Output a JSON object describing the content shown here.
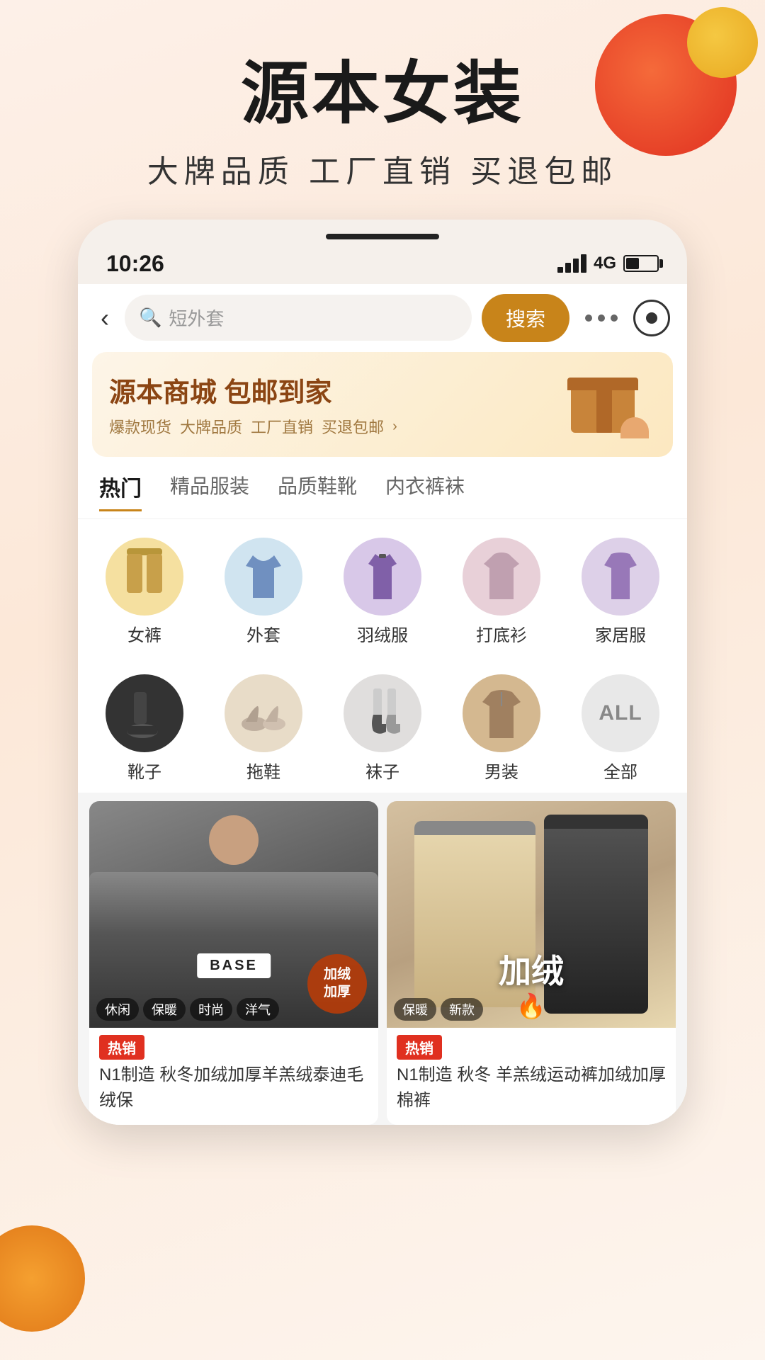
{
  "page": {
    "background": "#fdf0e8"
  },
  "header": {
    "main_title": "源本女装",
    "sub_title": "大牌品质  工厂直销  买退包邮"
  },
  "status_bar": {
    "time": "10:26",
    "signal": "4G"
  },
  "search": {
    "placeholder": "短外套",
    "button_label": "搜索"
  },
  "banner": {
    "title": "源本商城 包邮到家",
    "items": [
      {
        "text": "爆款现货"
      },
      {
        "text": "大牌品质"
      },
      {
        "text": "工厂直销"
      },
      {
        "text": "买退包邮"
      }
    ]
  },
  "category_tabs": [
    {
      "label": "热门",
      "active": true
    },
    {
      "label": "精品服装",
      "active": false
    },
    {
      "label": "品质鞋靴",
      "active": false
    },
    {
      "label": "内衣裤袜",
      "active": false
    }
  ],
  "categories_row1": [
    {
      "label": "女裤",
      "emoji": "👖",
      "color": "cc-yellow"
    },
    {
      "label": "外套",
      "emoji": "🧥",
      "color": "cc-blue"
    },
    {
      "label": "羽绒服",
      "emoji": "🥼",
      "color": "cc-purple"
    },
    {
      "label": "打底衫",
      "emoji": "👕",
      "color": "cc-pink"
    },
    {
      "label": "家居服",
      "emoji": "🩴",
      "color": "cc-lavender"
    }
  ],
  "categories_row2": [
    {
      "label": "靴子",
      "emoji": "👢",
      "color": "cc-dark"
    },
    {
      "label": "拖鞋",
      "emoji": "🩴",
      "color": "cc-beige"
    },
    {
      "label": "袜子",
      "emoji": "🧦",
      "color": "cc-gray"
    },
    {
      "label": "男装",
      "emoji": "🧣",
      "color": "cc-tan"
    },
    {
      "label": "全部",
      "text": "ALL",
      "color": "cc-all"
    }
  ],
  "products": [
    {
      "hot_label": "热销",
      "description": "N1制造 秋冬加绒加厚羊羔绒泰迪毛绒保",
      "tags": [
        "休闲",
        "保暖",
        "时尚",
        "洋气"
      ],
      "badge": "加绒\n加厚"
    },
    {
      "hot_label": "热销",
      "description": "N1制造 秋冬 羊羔绒运动裤加绒加厚棉裤",
      "tags": [
        "保暖",
        "新款"
      ],
      "badge": "加绒"
    }
  ],
  "icons": {
    "back": "‹",
    "search": "🔍",
    "more": "•••",
    "camera": "⊙",
    "arrow_right": "›"
  }
}
